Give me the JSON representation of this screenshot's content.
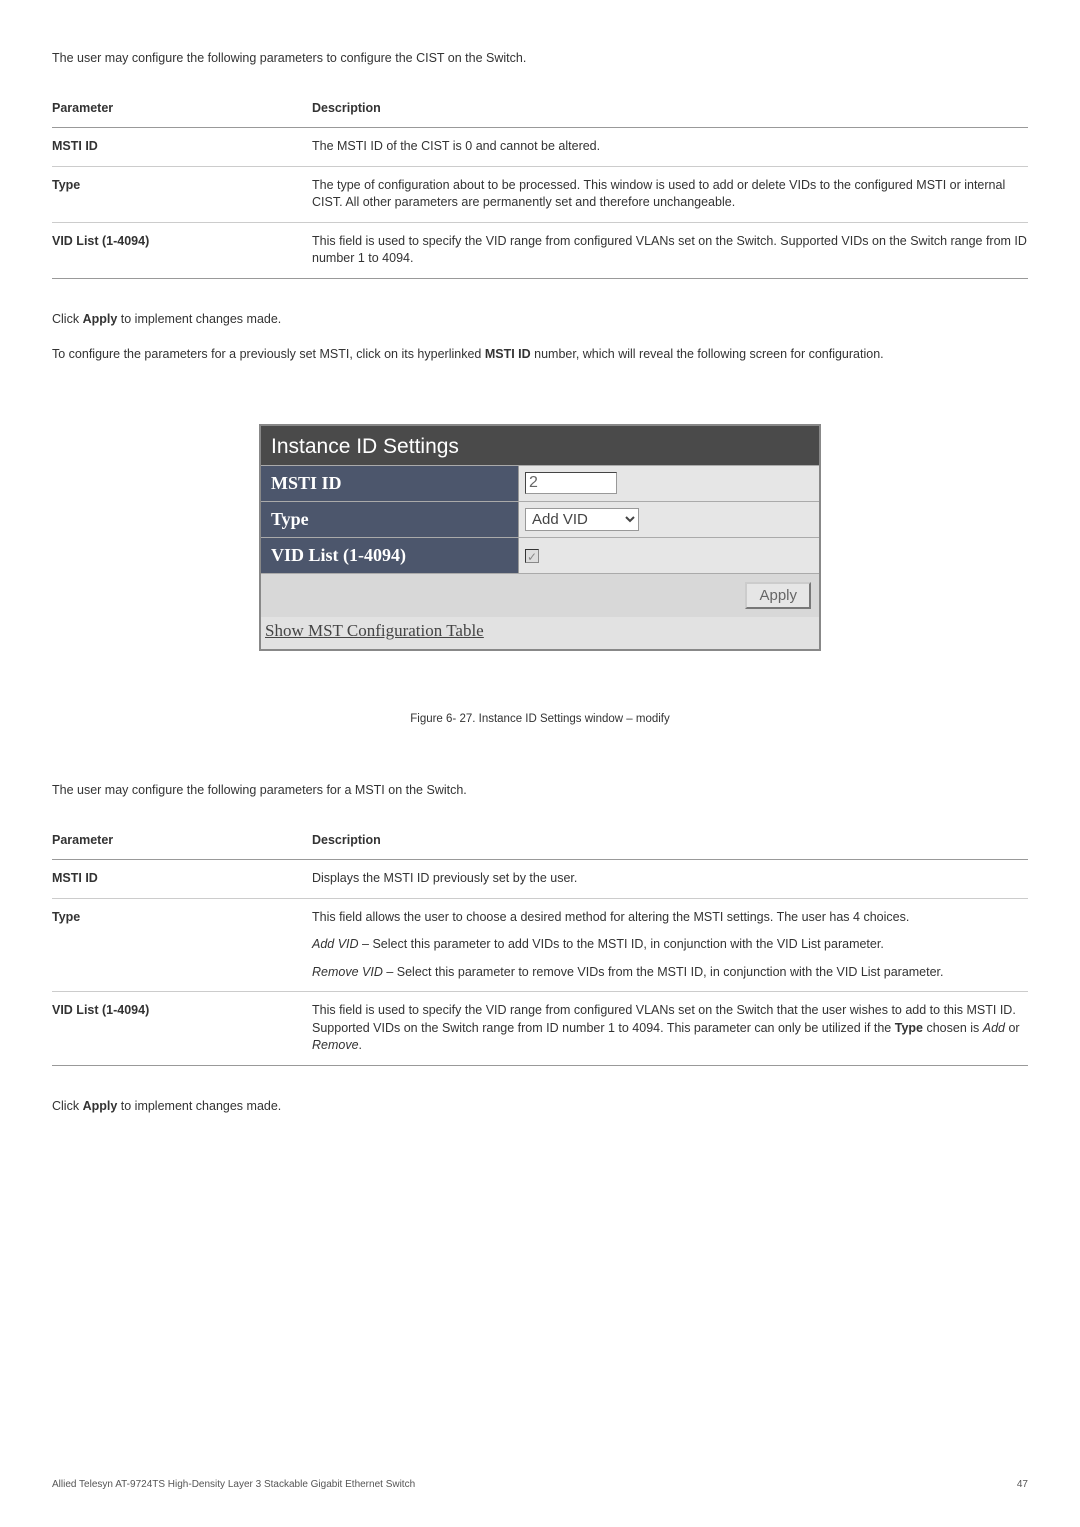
{
  "intro1": "The user may configure the following parameters to configure the CIST on the Switch.",
  "table1": {
    "headers": {
      "param": "Parameter",
      "desc": "Description"
    },
    "rows": [
      {
        "param": "MSTI ID",
        "desc": "The MSTI ID of the CIST is 0 and cannot be altered."
      },
      {
        "param": "Type",
        "desc": "The type of configuration about to be processed. This window is used to add or delete VIDs to the configured MSTI or internal CIST. All other parameters are permanently set and therefore unchangeable."
      },
      {
        "param": "VID List (1-4094)",
        "desc": "This field is used to specify the VID range from configured VLANs set on the Switch. Supported VIDs on the Switch range from ID number 1 to 4094."
      }
    ]
  },
  "apply_text_prefix": "Click ",
  "apply_text_bold": "Apply",
  "apply_text_suffix": " to implement changes made.",
  "configure_prefix": "To configure the parameters for a previously set MSTI, click on its hyperlinked ",
  "configure_bold": "MSTI ID",
  "configure_suffix": " number, which will reveal the following screen for configuration.",
  "settings": {
    "title": "Instance ID Settings",
    "rows": {
      "msti_label": "MSTI ID",
      "msti_value": "2",
      "type_label": "Type",
      "type_value": "Add VID",
      "vid_label": "VID List (1-4094)"
    },
    "apply_btn": "Apply",
    "link": "Show MST Configuration Table"
  },
  "figure_caption": "Figure 6- 27. Instance ID Settings window – modify",
  "intro2": "The user may configure the following parameters for a MSTI on the Switch.",
  "table2": {
    "headers": {
      "param": "Parameter",
      "desc": "Description"
    },
    "rows": {
      "r1": {
        "param": "MSTI ID",
        "desc": "Displays the MSTI ID previously set by the user."
      },
      "r2": {
        "param": "Type",
        "desc1": "This field allows the user to choose a desired method for altering the MSTI settings. The user has 4 choices.",
        "desc2_em": "Add VID",
        "desc2_rest": " – Select this parameter to add VIDs to the MSTI ID, in conjunction with the VID List parameter.",
        "desc3_em": "Remove VID",
        "desc3_rest": " – Select this parameter to remove VIDs from the MSTI ID, in conjunction with the VID List parameter."
      },
      "r3": {
        "param": "VID List (1-4094)",
        "desc_prefix": "This field is used to specify the VID range from configured VLANs set on the Switch that the user wishes to add to this MSTI ID. Supported VIDs on the Switch range from ID number 1 to 4094. This parameter can only be utilized if the ",
        "desc_bold": "Type",
        "desc_mid": " chosen is ",
        "desc_em1": "Add",
        "desc_or": " or ",
        "desc_em2": "Remove",
        "desc_end": "."
      }
    }
  },
  "footer_left": "Allied Telesyn AT-9724TS High-Density Layer 3 Stackable Gigabit Ethernet Switch",
  "footer_right": "47"
}
